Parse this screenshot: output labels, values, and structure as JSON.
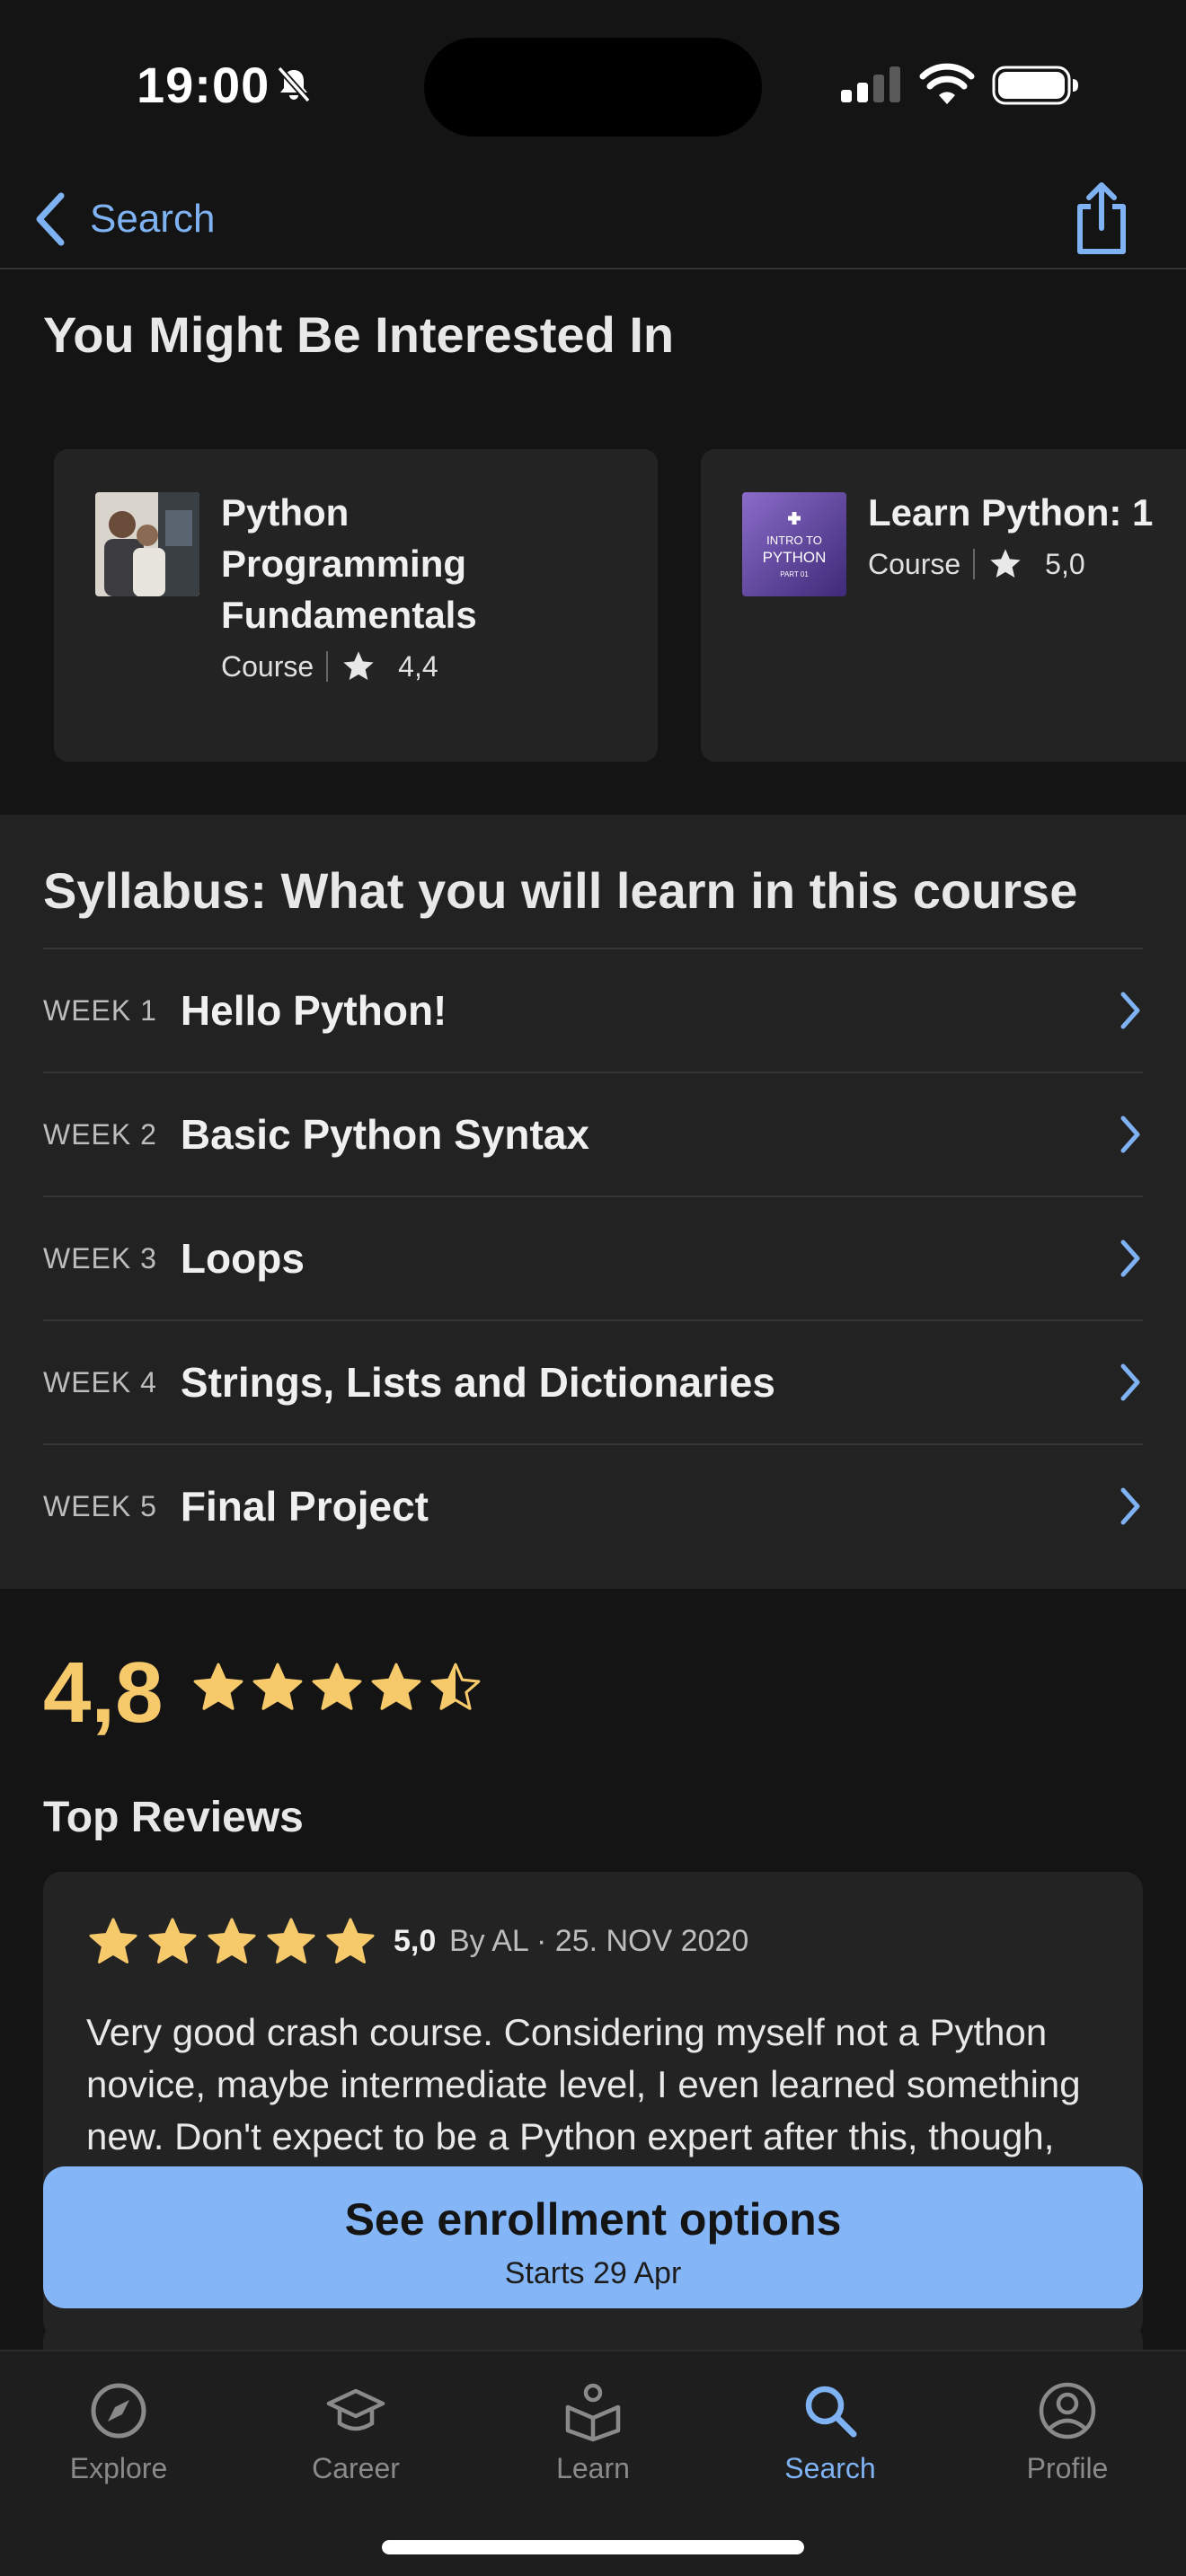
{
  "status_bar": {
    "time": "19:00"
  },
  "nav": {
    "back_label": "Search"
  },
  "recommended": {
    "title": "You Might Be Interested In",
    "cards": [
      {
        "name": "Python Programming Fundamentals",
        "type": "Course",
        "rating": "4,4"
      },
      {
        "name": "Learn Python: 1",
        "type": "Course",
        "rating": "5,0",
        "thumb_text_1": "INTRO TO",
        "thumb_text_2": "PYTHON",
        "thumb_text_3": "PART 01"
      }
    ]
  },
  "syllabus": {
    "title": "Syllabus: What you will learn in this course",
    "weeks": [
      {
        "label": "WEEK 1",
        "name": "Hello Python!"
      },
      {
        "label": "WEEK 2",
        "name": "Basic Python Syntax"
      },
      {
        "label": "WEEK 3",
        "name": "Loops"
      },
      {
        "label": "WEEK 4",
        "name": "Strings, Lists and Dictionaries"
      },
      {
        "label": "WEEK 5",
        "name": "Final Project"
      }
    ]
  },
  "rating": {
    "value": "4,8",
    "stars": 4.5
  },
  "reviews": {
    "title": "Top Reviews",
    "items": [
      {
        "stars": 5,
        "score": "5,0",
        "byline": "By AL · 25. NOV 2020",
        "text": "Very good crash course.  Considering myself not a Python novice, maybe intermediate level, I even learned something new. Don't expect to be a Python expert after this, though,"
      }
    ]
  },
  "enroll": {
    "label": "See enrollment options",
    "sub": "Starts 29 Apr"
  },
  "tabs": [
    {
      "label": "Explore",
      "icon": "compass-icon",
      "active": false
    },
    {
      "label": "Career",
      "icon": "graduation-cap-icon",
      "active": false
    },
    {
      "label": "Learn",
      "icon": "learn-book-icon",
      "active": false
    },
    {
      "label": "Search",
      "icon": "search-icon",
      "active": true
    },
    {
      "label": "Profile",
      "icon": "profile-icon",
      "active": false
    }
  ],
  "colors": {
    "accent": "#7fb2f2",
    "star": "#f6c96b",
    "cta": "#84b5f6",
    "background": "#141414",
    "card": "#232323"
  }
}
